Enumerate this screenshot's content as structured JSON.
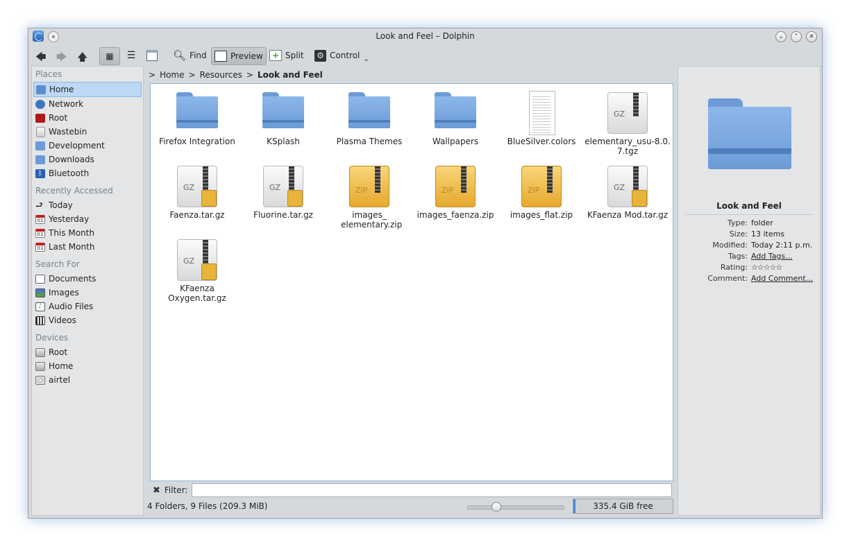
{
  "window": {
    "title": "Look and Feel – Dolphin"
  },
  "toolbar": {
    "find_label": "Find",
    "preview_label": "Preview",
    "split_label": "Split",
    "control_label": "Control"
  },
  "places": {
    "groups": [
      {
        "label": "Places",
        "items": [
          {
            "label": "Home",
            "icon": "home-icon",
            "selected": true
          },
          {
            "label": "Network",
            "icon": "network-icon"
          },
          {
            "label": "Root",
            "icon": "root-folder-icon"
          },
          {
            "label": "Wastebin",
            "icon": "trash-icon"
          },
          {
            "label": "Development",
            "icon": "folder-icon"
          },
          {
            "label": "Downloads",
            "icon": "folder-icon"
          },
          {
            "label": "Bluetooth",
            "icon": "bluetooth-icon"
          }
        ]
      },
      {
        "label": "Recently Accessed",
        "items": [
          {
            "label": "Today",
            "icon": "arrow-icon"
          },
          {
            "label": "Yesterday",
            "icon": "calendar-icon"
          },
          {
            "label": "This Month",
            "icon": "calendar-icon"
          },
          {
            "label": "Last Month",
            "icon": "calendar-icon"
          }
        ]
      },
      {
        "label": "Search For",
        "items": [
          {
            "label": "Documents",
            "icon": "document-icon"
          },
          {
            "label": "Images",
            "icon": "image-icon"
          },
          {
            "label": "Audio Files",
            "icon": "audio-icon"
          },
          {
            "label": "Videos",
            "icon": "video-icon"
          }
        ]
      },
      {
        "label": "Devices",
        "items": [
          {
            "label": "Root",
            "icon": "drive-icon"
          },
          {
            "label": "Home",
            "icon": "drive-icon"
          },
          {
            "label": "airtel",
            "icon": "optical-drive-icon"
          }
        ]
      }
    ]
  },
  "breadcrumb": {
    "items": [
      "Home",
      "Resources",
      "Look and Feel"
    ]
  },
  "files": [
    {
      "name": "Firefox Integration",
      "kind": "folder"
    },
    {
      "name": "KSplash",
      "kind": "folder"
    },
    {
      "name": "Plasma Themes",
      "kind": "folder"
    },
    {
      "name": "Wallpapers",
      "kind": "folder"
    },
    {
      "name": "BlueSilver.colors",
      "kind": "text"
    },
    {
      "name": "elementary_usu-8.0.7.tgz",
      "kind": "gz"
    },
    {
      "name": "Faenza.tar.gz",
      "kind": "gz"
    },
    {
      "name": "Fluorine.tar.gz",
      "kind": "gz"
    },
    {
      "name": "images_ elementary.zip",
      "kind": "zip"
    },
    {
      "name": "images_faenza.zip",
      "kind": "zip"
    },
    {
      "name": "images_flat.zip",
      "kind": "zip"
    },
    {
      "name": "KFaenza Mod.tar.gz",
      "kind": "gz"
    },
    {
      "name": "KFaenza Oxygen.tar.gz",
      "kind": "gz"
    }
  ],
  "filter": {
    "label": "Filter:",
    "value": ""
  },
  "status": {
    "summary": "4 Folders, 9 Files (209.3 MiB)",
    "free_space": "335.4 GiB free",
    "zoom_level": 0.27,
    "used_fraction": 0.02
  },
  "info_panel": {
    "name": "Look and Feel",
    "rows": [
      {
        "key": "Type:",
        "value": "folder"
      },
      {
        "key": "Size:",
        "value": "13 items"
      },
      {
        "key": "Modified:",
        "value": "Today 2:11 p.m."
      },
      {
        "key": "Tags:",
        "value": "Add Tags...",
        "link": true
      },
      {
        "key": "Rating:",
        "value": "☆☆☆☆☆",
        "stars": true
      },
      {
        "key": "Comment:",
        "value": "Add Comment...",
        "link": true
      }
    ]
  },
  "colors": {
    "selection": "#bcd8f4",
    "accent": "#2a6cc2",
    "folder": "#6c9bd6"
  }
}
